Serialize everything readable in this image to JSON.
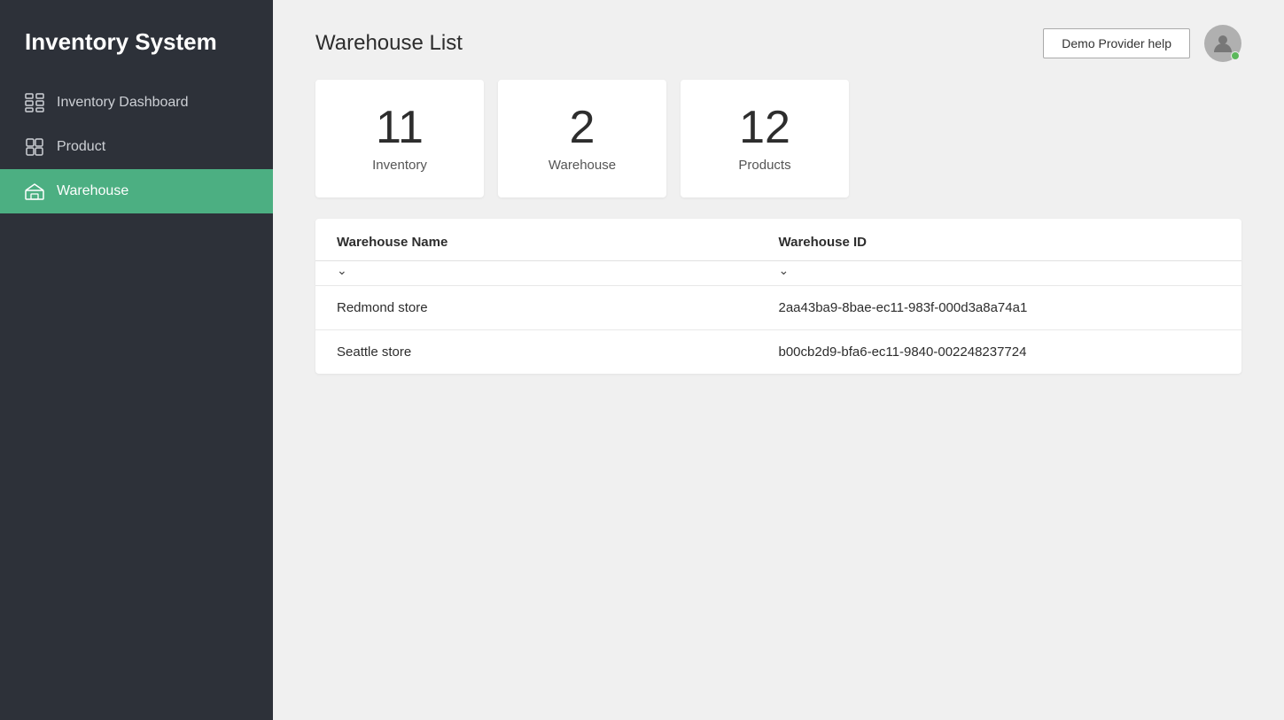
{
  "app": {
    "title": "Inventory System"
  },
  "sidebar": {
    "items": [
      {
        "id": "inventory-dashboard",
        "label": "Inventory Dashboard",
        "icon": "dashboard-icon"
      },
      {
        "id": "product",
        "label": "Product",
        "icon": "product-icon"
      },
      {
        "id": "warehouse",
        "label": "Warehouse",
        "icon": "warehouse-icon",
        "active": true
      }
    ]
  },
  "header": {
    "page_title": "Warehouse List",
    "help_button_label": "Demo Provider help"
  },
  "stats": [
    {
      "id": "inventory-stat",
      "number": "11",
      "label": "Inventory"
    },
    {
      "id": "warehouse-stat",
      "number": "2",
      "label": "Warehouse"
    },
    {
      "id": "products-stat",
      "number": "12",
      "label": "Products"
    }
  ],
  "table": {
    "col1_header": "Warehouse Name",
    "col2_header": "Warehouse ID",
    "rows": [
      {
        "name": "Redmond store",
        "id": "2aa43ba9-8bae-ec11-983f-000d3a8a74a1"
      },
      {
        "name": "Seattle store",
        "id": "b00cb2d9-bfa6-ec11-9840-002248237724"
      }
    ]
  }
}
